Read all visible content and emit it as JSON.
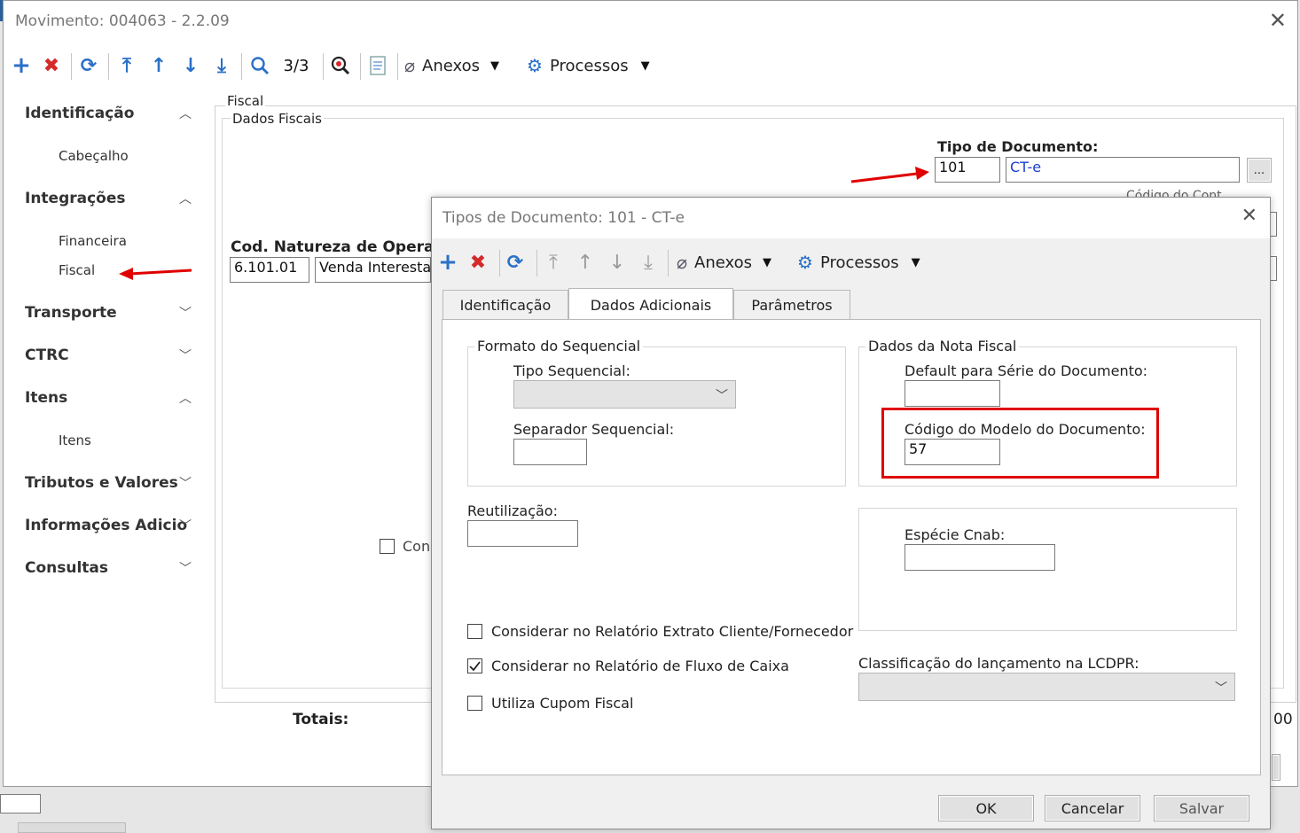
{
  "main_window": {
    "title": "Movimento: 004063 - 2.2.09",
    "close": "✕",
    "toolbar": {
      "record_counter": "3/3",
      "attachments": "Anexos",
      "processes": "Processos"
    },
    "sidebar": [
      {
        "label": "Identificação",
        "expanded": true
      },
      {
        "label": "Cabeçalho"
      },
      {
        "label": "Integrações",
        "expanded": true
      },
      {
        "label": "Financeira"
      },
      {
        "label": "Fiscal"
      },
      {
        "label": "Transporte",
        "expanded": false
      },
      {
        "label": "CTRC",
        "expanded": false
      },
      {
        "label": "Itens",
        "expanded": true
      },
      {
        "label": "Itens"
      },
      {
        "label": "Tributos e Valores",
        "expanded": false
      },
      {
        "label": "Informações Adicio",
        "expanded": false
      },
      {
        "label": "Consultas",
        "expanded": false
      }
    ],
    "fiscal": {
      "section_label": "Fiscal",
      "group_label": "Dados Fiscais",
      "doc_type_label": "Tipo de Documento:",
      "doc_type_code": "101",
      "doc_type_name": "CT-e",
      "lookup_button": "...",
      "nature_label": "Cod. Natureza de Operaçã",
      "nature_code": "6.101.01",
      "nature_desc": "Venda Interestadu",
      "partial_checkbox_label": "Cons",
      "partial_label_behind": "Código do Cont",
      "totals_label": "Totais:",
      "totals_value_partial": "00"
    }
  },
  "dialog": {
    "title": "Tipos de Documento: 101 - CT-e",
    "close": "✕",
    "toolbar": {
      "attachments": "Anexos",
      "processes": "Processos"
    },
    "tabs": [
      "Identificação",
      "Dados Adicionais",
      "Parâmetros"
    ],
    "active_tab": "Dados Adicionais",
    "sequence_format": {
      "group_label": "Formato do Sequencial",
      "type_label": "Tipo Sequencial:",
      "type_value": "",
      "separator_label": "Separador Sequencial:",
      "separator_value": ""
    },
    "invoice_data": {
      "group_label": "Dados da Nota Fiscal",
      "default_series_label": "Default para Série do Documento:",
      "default_series_value": "",
      "model_code_label": "Código do Modelo do Documento:",
      "model_code_value": "57"
    },
    "reuse_label": "Reutilização:",
    "reuse_value": "",
    "cnab_label": "Espécie Cnab:",
    "cnab_value": "",
    "checkboxes": [
      {
        "label": "Considerar no Relatório Extrato Cliente/Fornecedor",
        "checked": false
      },
      {
        "label": "Considerar no Relatório de Fluxo de Caixa",
        "checked": true
      },
      {
        "label": "Utiliza Cupom Fiscal",
        "checked": false
      }
    ],
    "lcdpr_label": "Classificação do lançamento na LCDPR:",
    "lcdpr_value": "",
    "buttons": {
      "ok": "OK",
      "cancel": "Cancelar",
      "save": "Salvar"
    }
  },
  "colors": {
    "accent_blue": "#2a70c8",
    "delete_red": "#d42a2a",
    "highlight_red": "#e00000"
  }
}
